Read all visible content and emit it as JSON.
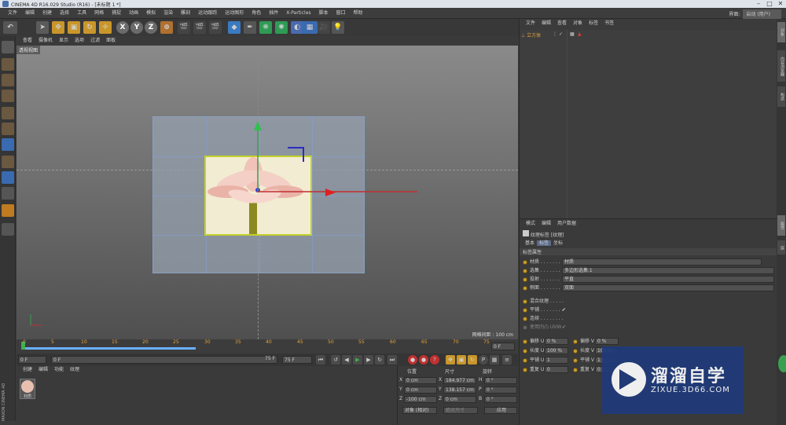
{
  "title": "CINEMA 4D R16.029 Studio (R16) - [未标题 1 *]",
  "menu": [
    "文件",
    "编辑",
    "创建",
    "选择",
    "工具",
    "网格",
    "捕捉",
    "动画",
    "模拟",
    "渲染",
    "雕刻",
    "运动跟踪",
    "运动图形",
    "角色",
    "插件",
    "X-Particles",
    "脚本",
    "窗口",
    "帮助"
  ],
  "interface": {
    "label": "界面:",
    "value": "启动 (用户)"
  },
  "toolbar": {
    "x": "X",
    "y": "Y",
    "z": "Z"
  },
  "view_menu": [
    "查看",
    "摄像机",
    "显示",
    "选项",
    "过滤",
    "面板"
  ],
  "viewport": {
    "label": "透视视图",
    "scale": "网格间距 : 100 cm"
  },
  "timeline_ticks": [
    "0",
    "5",
    "10",
    "15",
    "20",
    "25",
    "30",
    "35",
    "40",
    "45",
    "50",
    "55",
    "60",
    "65",
    "70",
    "75"
  ],
  "timeline_end": "0 F",
  "playbar": {
    "start": "0 F",
    "current": "0 F",
    "end": "75 F",
    "max": "75 F"
  },
  "material_menu": [
    "创建",
    "编辑",
    "功能",
    "纹理"
  ],
  "material": {
    "name": "材质"
  },
  "coords": {
    "headers": [
      "位置",
      "尺寸",
      "旋转"
    ],
    "rows": [
      {
        "axis": "X",
        "pos": "0 cm",
        "size": "184.977 cm",
        "rot_axis": "H",
        "rot": "0 °"
      },
      {
        "axis": "Y",
        "pos": "0 cm",
        "size": "138.157 cm",
        "rot_axis": "P",
        "rot": "0 °"
      },
      {
        "axis": "Z",
        "pos": "-100 cm",
        "size": "0 cm",
        "rot_axis": "B",
        "rot": "0 °"
      }
    ],
    "mode": "对象 (相对)",
    "size_mode": "绝对尺寸",
    "apply": "应用"
  },
  "object_menu": [
    "文件",
    "编辑",
    "查看",
    "对象",
    "标签",
    "书签"
  ],
  "object": {
    "name": "立方体"
  },
  "attr_menu": [
    "模式",
    "编辑",
    "用户数据"
  ],
  "attr": {
    "tag_title": "纹理标签 [纹理]",
    "tabs": [
      "基本",
      "标签",
      "坐标"
    ],
    "section": "标签属性",
    "rows": [
      {
        "label": "材质 . . . . . . . .",
        "value": "材质"
      },
      {
        "label": "选集 . . . . . . . .",
        "value": "多边形选集.1"
      },
      {
        "label": "投射 . . . . . . . .",
        "value": "平直"
      },
      {
        "label": "侧面 . . . . . . . .",
        "value": "双面"
      }
    ],
    "checks": [
      {
        "label": "混合纹理 . . . . .",
        "value": ""
      },
      {
        "label": "平铺 . . . . . . . .",
        "value": "✔"
      },
      {
        "label": "连续 . . . . . . . .",
        "value": ""
      },
      {
        "label": "使用凹凸 UVW",
        "value": "✔"
      }
    ],
    "offset": [
      {
        "l": "偏移 U",
        "v": "0 %",
        "l2": "偏移 V",
        "v2": "0 %"
      },
      {
        "l": "长度 U",
        "v": "100 %",
        "l2": "长度 V",
        "v2": "100 %"
      },
      {
        "l": "平铺 U",
        "v": "1",
        "l2": "平铺 V",
        "v2": "1"
      },
      {
        "l": "重复 U",
        "v": "0",
        "l2": "重复 V",
        "v2": "0"
      }
    ]
  },
  "watermark": {
    "title": "溜溜自学",
    "url": "ZIXUE.3D66.COM"
  },
  "side_tabs": [
    "对象",
    "内容浏览器",
    "构造",
    "属性",
    "层"
  ],
  "maxon": "MAXON CINEMA 4D"
}
